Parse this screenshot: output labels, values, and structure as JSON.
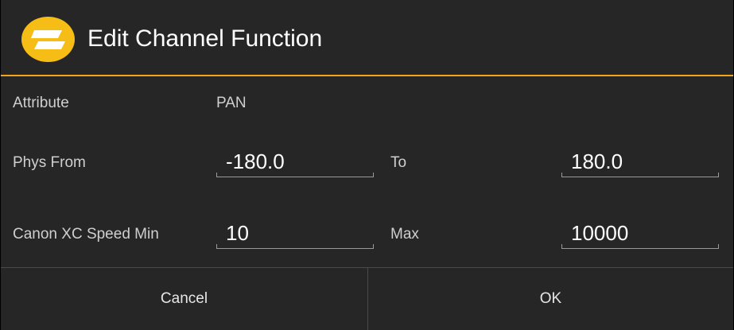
{
  "dialog": {
    "title": "Edit Channel Function",
    "logo_icon": "brand-logo-icon",
    "accent_color": "#f3a41b",
    "background_color": "#262626"
  },
  "form": {
    "attribute": {
      "label": "Attribute",
      "value": "PAN"
    },
    "phys_from": {
      "label": "Phys From",
      "value": "-180.0"
    },
    "phys_to": {
      "label": "To",
      "value": "180.0"
    },
    "speed_min": {
      "label": "Canon XC Speed Min",
      "value": "10"
    },
    "speed_max": {
      "label": "Max",
      "value": "10000"
    }
  },
  "buttons": {
    "cancel": "Cancel",
    "ok": "OK"
  }
}
